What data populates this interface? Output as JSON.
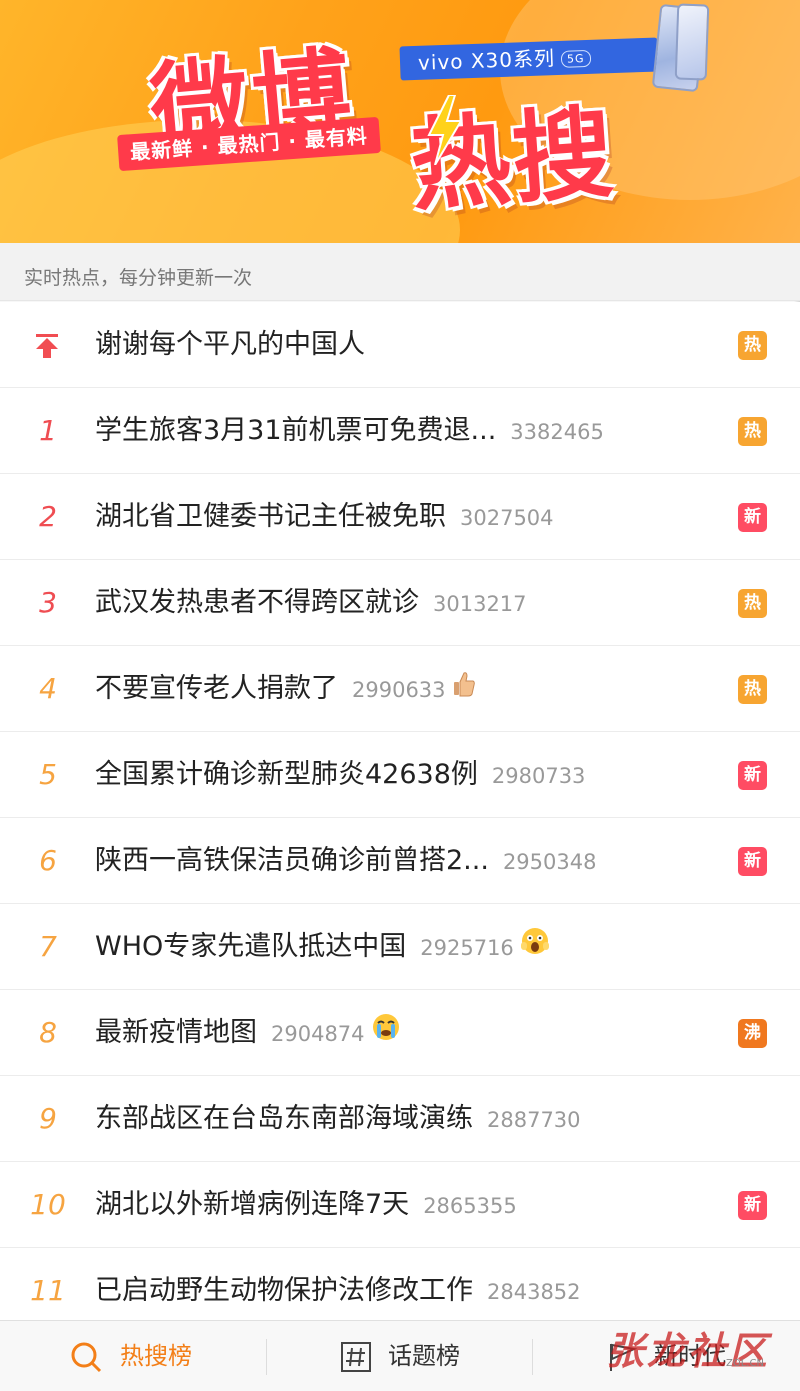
{
  "banner": {
    "title_line1": "微博",
    "title_line2": "热搜",
    "slogan": "最新鲜 · 最热门 · 最有料",
    "ad_text": "vivo X30系列",
    "ad_tag": "5G"
  },
  "subheader": "实时热点，每分钟更新一次",
  "pinned": {
    "title": "谢谢每个平凡的中国人",
    "badge": "热"
  },
  "items": [
    {
      "rank": "1",
      "title": "学生旅客3月31前机票可免费退...",
      "count": "3382465",
      "badge": "热",
      "badge_type": "hot"
    },
    {
      "rank": "2",
      "title": "湖北省卫健委书记主任被免职",
      "count": "3027504",
      "badge": "新",
      "badge_type": "new"
    },
    {
      "rank": "3",
      "title": "武汉发热患者不得跨区就诊",
      "count": "3013217",
      "badge": "热",
      "badge_type": "hot"
    },
    {
      "rank": "4",
      "title": "不要宣传老人捐款了",
      "count": "2990633",
      "badge": "热",
      "badge_type": "hot",
      "emoji": "thumbs-up-icon"
    },
    {
      "rank": "5",
      "title": "全国累计确诊新型肺炎42638例",
      "count": "2980733",
      "badge": "新",
      "badge_type": "new"
    },
    {
      "rank": "6",
      "title": "陕西一高铁保洁员确诊前曾搭2...",
      "count": "2950348",
      "badge": "新",
      "badge_type": "new"
    },
    {
      "rank": "7",
      "title": "WHO专家先遣队抵达中国",
      "count": "2925716",
      "badge": "",
      "badge_type": "",
      "emoji": "scared-face-icon"
    },
    {
      "rank": "8",
      "title": "最新疫情地图",
      "count": "2904874",
      "badge": "沸",
      "badge_type": "boil",
      "emoji": "crying-face-icon"
    },
    {
      "rank": "9",
      "title": "东部战区在台岛东南部海域演练",
      "count": "2887730",
      "badge": "",
      "badge_type": ""
    },
    {
      "rank": "10",
      "title": "湖北以外新增病例连降7天",
      "count": "2865355",
      "badge": "新",
      "badge_type": "new"
    },
    {
      "rank": "11",
      "title": "已启动野生动物保护法修改工作",
      "count": "2843852",
      "badge": "",
      "badge_type": ""
    }
  ],
  "nav": {
    "hot_search": "热搜榜",
    "topics": "话题榜",
    "new_era": "新时代"
  },
  "watermark": "张龙社区",
  "watermark_url": "ZOL.CN",
  "colors": {
    "accent_orange": "#f37f18",
    "rank_red": "#ef4d52",
    "badge_hot": "#f7a531",
    "badge_new": "#ff4c63",
    "badge_boil": "#f0781f"
  }
}
